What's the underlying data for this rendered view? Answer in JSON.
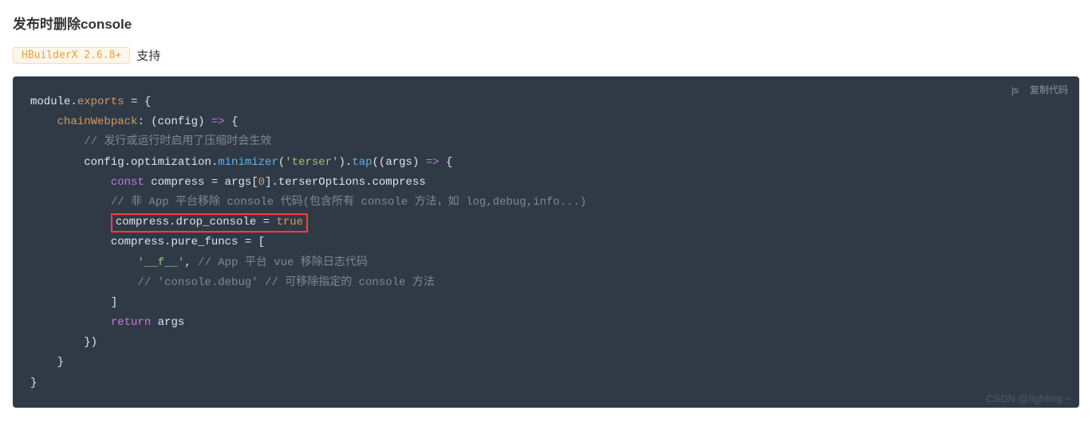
{
  "heading": "发布时删除console",
  "versionTag": "HBuilderX 2.6.8+",
  "supportText": "支持",
  "code": {
    "lang": "js",
    "copyLabel": "复制代码",
    "l1a": "module",
    "l1b": ".",
    "l1c": "exports",
    "l1d": " = {",
    "l2a": "chainWebpack",
    "l2b": ": (",
    "l2c": "config",
    "l2d": ") ",
    "l2e": "=>",
    "l2f": " {",
    "l3": "// 发行或运行时启用了压缩时会生效",
    "l4a": "config.optimization.",
    "l4b": "minimizer",
    "l4c": "(",
    "l4d": "'terser'",
    "l4e": ").",
    "l4f": "tap",
    "l4g": "((",
    "l4h": "args",
    "l4i": ") ",
    "l4j": "=>",
    "l4k": " {",
    "l5a": "const",
    "l5b": " compress = args[",
    "l5c": "0",
    "l5d": "].terserOptions.compress",
    "l6": "// 非 App 平台移除 console 代码(包含所有 console 方法，如 log,debug,info...)",
    "l7a": "compress.drop_console = ",
    "l7b": "true",
    "l8": "compress.pure_funcs = [",
    "l9a": "'__f__'",
    "l9b": ", ",
    "l9c": "// App 平台 vue 移除日志代码",
    "l10": "// 'console.debug' // 可移除指定的 console 方法",
    "l11": "]",
    "l12a": "return",
    "l12b": " args",
    "l13": "})",
    "l14": "}",
    "l15": "}"
  },
  "watermark": "CSDN @fighting ~"
}
